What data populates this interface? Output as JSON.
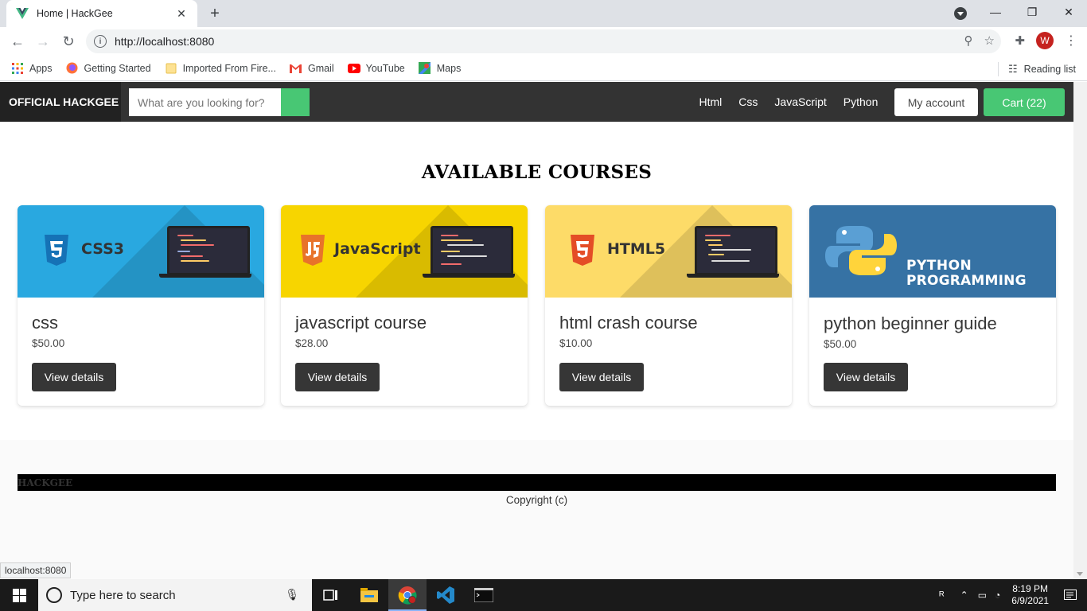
{
  "browser": {
    "tab_title": "Home | HackGee",
    "url": "http://localhost:8080",
    "bookmarks": [
      "Apps",
      "Getting Started",
      "Imported From Fire...",
      "Gmail",
      "YouTube",
      "Maps"
    ],
    "reading_list": "Reading list",
    "avatar_letter": "W",
    "status_url": "localhost:8080"
  },
  "site": {
    "brand": "OFFICIAL HACKGEE",
    "search_placeholder": "What are you looking for?",
    "nav_links": [
      "Html",
      "Css",
      "JavaScript",
      "Python"
    ],
    "account_label": "My account",
    "cart_label": "Cart (22)",
    "heading": "AVAILABLE COURSES",
    "courses": [
      {
        "title": "css",
        "price": "$50.00",
        "button": "View details",
        "banner_text": "CSS3",
        "banner_color": "#29a8e0"
      },
      {
        "title": "javascript course",
        "price": "$28.00",
        "button": "View details",
        "banner_text": "JavaScript",
        "banner_color": "#f7d500"
      },
      {
        "title": "html crash course",
        "price": "$10.00",
        "button": "View details",
        "banner_text": "HTML5",
        "banner_color": "#fddb68"
      },
      {
        "title": "python beginner guide",
        "price": "$50.00",
        "button": "View details",
        "banner_text_line1": "PYTHON",
        "banner_text_line2": "PROGRAMMING",
        "banner_color": "#3672a4"
      }
    ],
    "footer_brand": "HACKGEE",
    "copyright": "Copyright (c)"
  },
  "taskbar": {
    "search_placeholder": "Type here to search",
    "time": "8:19 PM",
    "date": "6/9/2021"
  },
  "colors": {
    "accent_green": "#48c774",
    "nav_dark": "#333333",
    "button_dark": "#363636"
  }
}
